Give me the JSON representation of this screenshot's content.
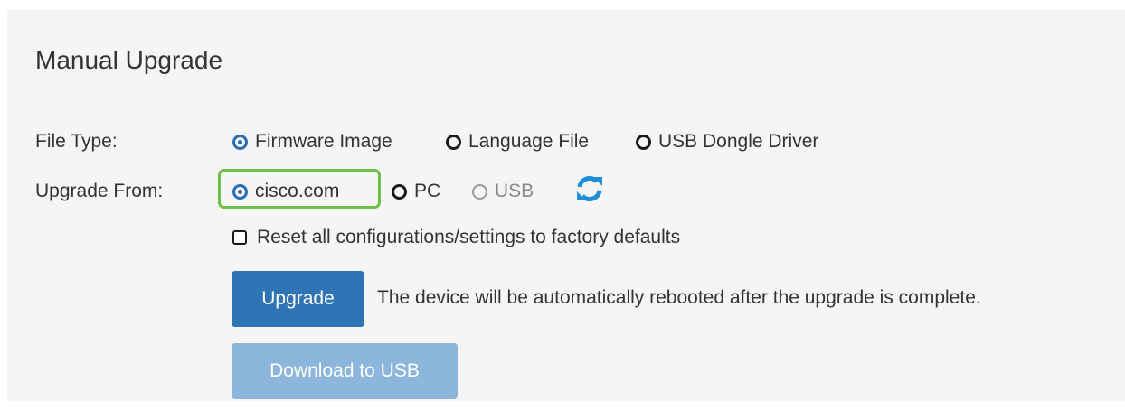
{
  "section": {
    "title": "Manual Upgrade"
  },
  "file_type": {
    "label": "File Type:",
    "options": [
      {
        "label": "Firmware Image",
        "checked": true,
        "disabled": false
      },
      {
        "label": "Language File",
        "checked": false,
        "disabled": false
      },
      {
        "label": "USB Dongle Driver",
        "checked": false,
        "disabled": false
      }
    ]
  },
  "upgrade_from": {
    "label": "Upgrade From:",
    "options": [
      {
        "label": "cisco.com",
        "checked": true,
        "disabled": false,
        "highlighted": true
      },
      {
        "label": "PC",
        "checked": false,
        "disabled": false
      },
      {
        "label": "USB",
        "checked": false,
        "disabled": true
      }
    ],
    "refresh_icon": "refresh-icon"
  },
  "reset": {
    "label": "Reset all configurations/settings to factory defaults",
    "checked": false
  },
  "actions": {
    "upgrade_label": "Upgrade",
    "upgrade_note": "The device will be automatically rebooted after the upgrade is complete.",
    "download_usb_label": "Download to USB"
  },
  "colors": {
    "accent": "#2f74b5",
    "accent_disabled": "#8db6dd",
    "highlight": "#6cc04a",
    "refresh": "#1e8fd6"
  }
}
